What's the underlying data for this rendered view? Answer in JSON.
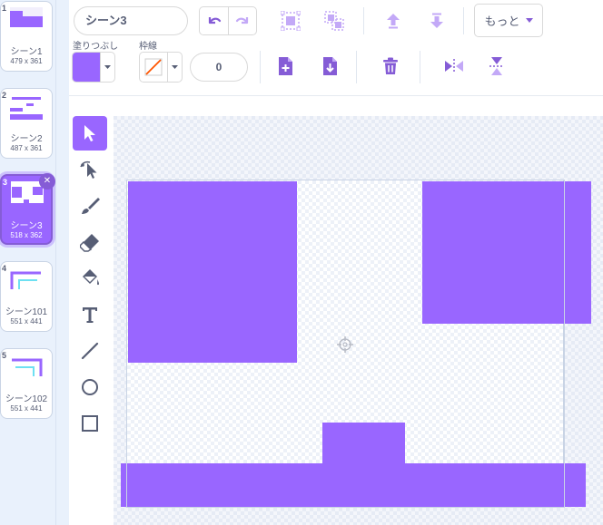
{
  "costumes": [
    {
      "number": "1",
      "name": "シーン1",
      "size": "479 x 361",
      "selected": false
    },
    {
      "number": "2",
      "name": "シーン2",
      "size": "487 x 361",
      "selected": false
    },
    {
      "number": "3",
      "name": "シーン3",
      "size": "518 x 362",
      "selected": true
    },
    {
      "number": "4",
      "name": "シーン101",
      "size": "551 x 441",
      "selected": false
    },
    {
      "number": "5",
      "name": "シーン102",
      "size": "551 x 441",
      "selected": false
    }
  ],
  "editor": {
    "costume_name": "シーン3",
    "more_label": "もっと",
    "fill_label": "塗りつぶし",
    "outline_label": "枠線",
    "outline_width": "0",
    "fill_color": "#9966ff"
  },
  "colors": {
    "accent": "#9966ff",
    "accent_dark": "#855cd6",
    "icon": "#855cd6",
    "icon_disabled": "#c3a9f7"
  },
  "tools": [
    "select-tool",
    "reshape-tool",
    "brush-tool",
    "eraser-tool",
    "fill-tool",
    "text-tool",
    "line-tool",
    "circle-tool",
    "rectangle-tool"
  ],
  "active_tool": "select-tool"
}
